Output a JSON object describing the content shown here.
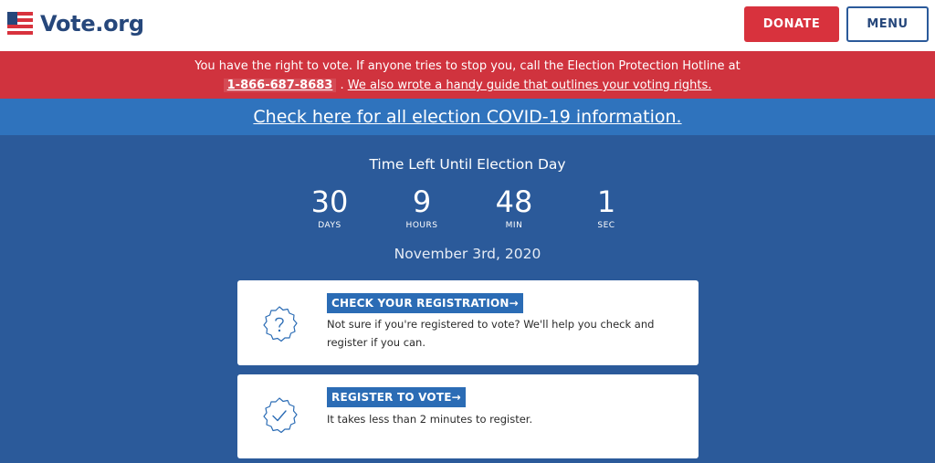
{
  "header": {
    "logo_text": "Vote.org",
    "donate_label": "DONATE",
    "menu_label": "MENU"
  },
  "alert": {
    "text_before": "You have the right to vote. If anyone tries to stop you, call the Election Protection Hotline at",
    "hotline": "1-866-687-8683",
    "separator": " . ",
    "guide_link": "We also wrote a handy guide that outlines your voting rights."
  },
  "covid": {
    "link": "Check here for all election COVID-19 information."
  },
  "countdown": {
    "title": "Time Left Until Election Day",
    "units": [
      {
        "value": "30",
        "label": "DAYS"
      },
      {
        "value": "9",
        "label": "HOURS"
      },
      {
        "value": "48",
        "label": "MIN"
      },
      {
        "value": "1",
        "label": "SEC"
      }
    ],
    "date": "November 3rd, 2020"
  },
  "cards": [
    {
      "icon": "question-badge-icon",
      "button": "CHECK YOUR REGISTRATION→",
      "text": "Not sure if you're registered to vote? We'll help you check and register if you can."
    },
    {
      "icon": "check-badge-icon",
      "button": "REGISTER TO VOTE→",
      "text": "It takes less than 2 minutes to register."
    }
  ],
  "colors": {
    "brand_blue": "#26477b",
    "brand_red": "#d8323d",
    "background_blue": "#2b5a9a",
    "covid_blue": "#2f73bd",
    "card_button_blue": "#2b6cb5"
  }
}
